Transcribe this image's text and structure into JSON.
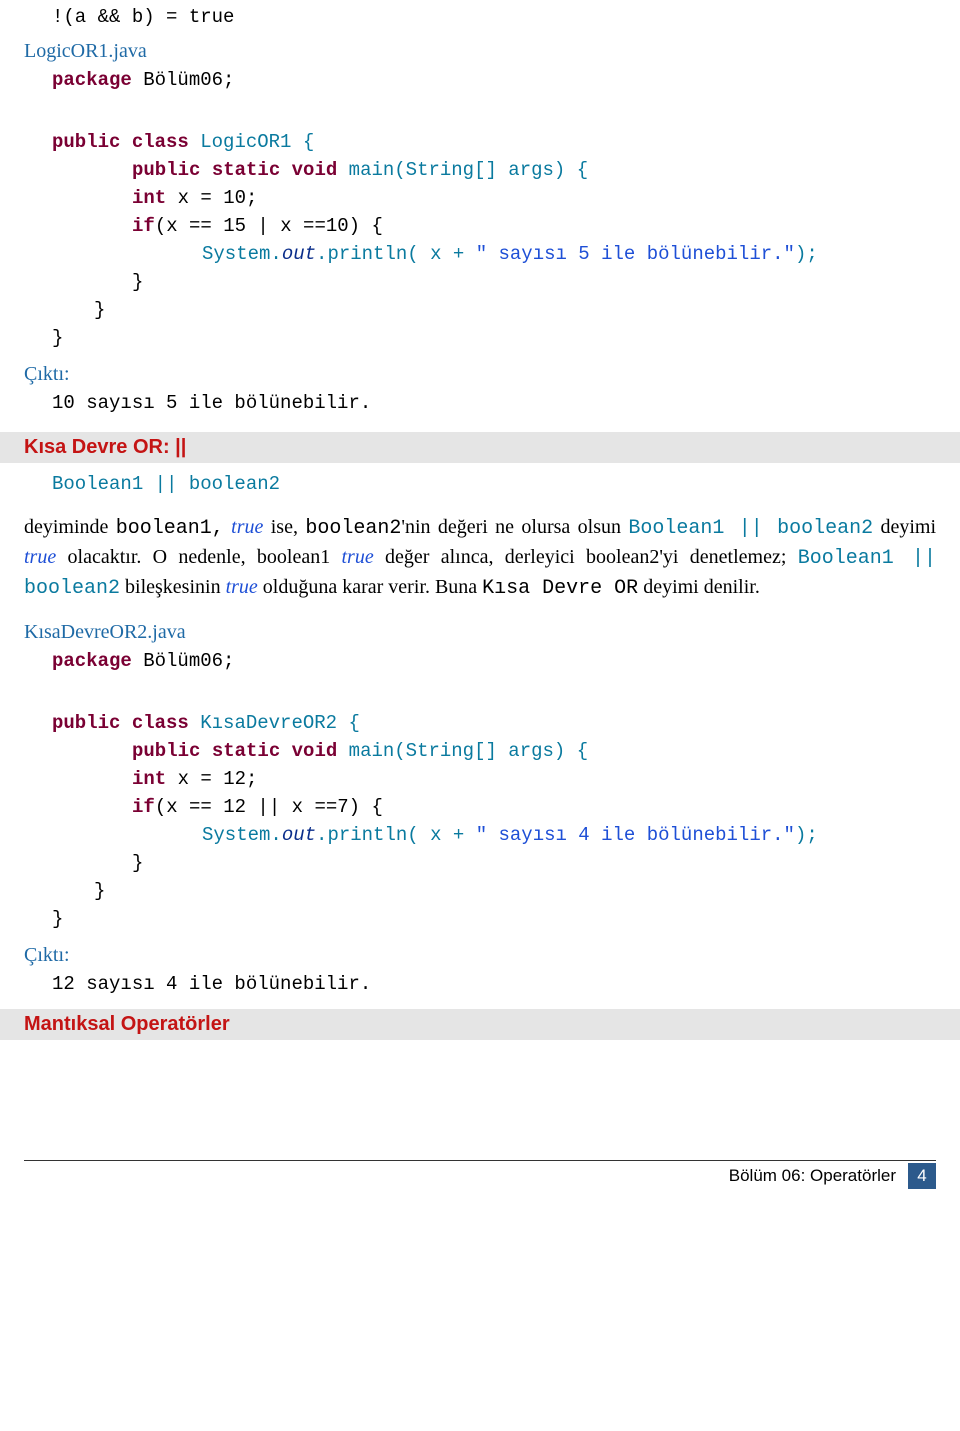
{
  "top_line": "!(a && b) = true",
  "file1_label": "LogicOR1.java",
  "code1": {
    "pkg_kw": "package",
    "pkg_name": " Bölüm06;",
    "pub": "public",
    "cls": "class",
    "cls_name": " LogicOR1 {",
    "static": "static",
    "void": "void",
    "main": " main(String[] args) {",
    "int_kw": "int",
    "x_decl": " x = 10;",
    "if_kw": "if",
    "cond": "(x == 15 | x ==10) {",
    "sys": "System.",
    "out": "out",
    "println": ".println( x + ",
    "str": "\" sayısı 5 ile bölünebilir.\"",
    "end": ");",
    "brace": "}"
  },
  "cikti1_label": "Çıktı:",
  "cikti1_text": "10 sayısı 5 ile bölünebilir.",
  "section1_title": "Kısa Devre OR: ||",
  "bool_expr": "Boolean1 || boolean2",
  "prose_parts": {
    "p1a": "deyiminde ",
    "p1b": "boolean1,",
    "true": " true ",
    "p1c": " ise, ",
    "p1d": "boolean2",
    "p1e": "'nin değeri ne olursa olsun ",
    "p1f": "Boolean1 || boolean2",
    "p1g": " deyimi ",
    "p1h": " olacaktır. O nedenle, boolean1 ",
    "p1i": " değer alınca, derleyici boolean2'yi denetlemez; ",
    "p1j": "Boolean1 || boolean2",
    "p1k": " bileşkesinin ",
    "p1l": " olduğuna karar verir. Buna ",
    "p1m": "Kısa Devre OR",
    "p1n": " deyimi denilir."
  },
  "file2_label": "KısaDevreOR2.java",
  "code2": {
    "pkg_kw": "package",
    "pkg_name": " Bölüm06;",
    "pub": "public",
    "cls": "class",
    "cls_name": " KısaDevreOR2 {",
    "static": "static",
    "void": "void",
    "main": " main(String[] args) {",
    "int_kw": "int",
    "x_decl": " x = 12;",
    "if_kw": "if",
    "cond": "(x == 12 || x ==7) {",
    "sys": "System.",
    "out": "out",
    "println": ".println( x + ",
    "str": "\" sayısı 4 ile bölünebilir.\"",
    "end": ");",
    "brace": "}"
  },
  "cikti2_label": "Çıktı:",
  "cikti2_text": "12 sayısı 4 ile bölünebilir.",
  "section2_title": "Mantıksal Operatörler",
  "footer_text": "Bölüm 06: Operatörler",
  "page_number": "4"
}
